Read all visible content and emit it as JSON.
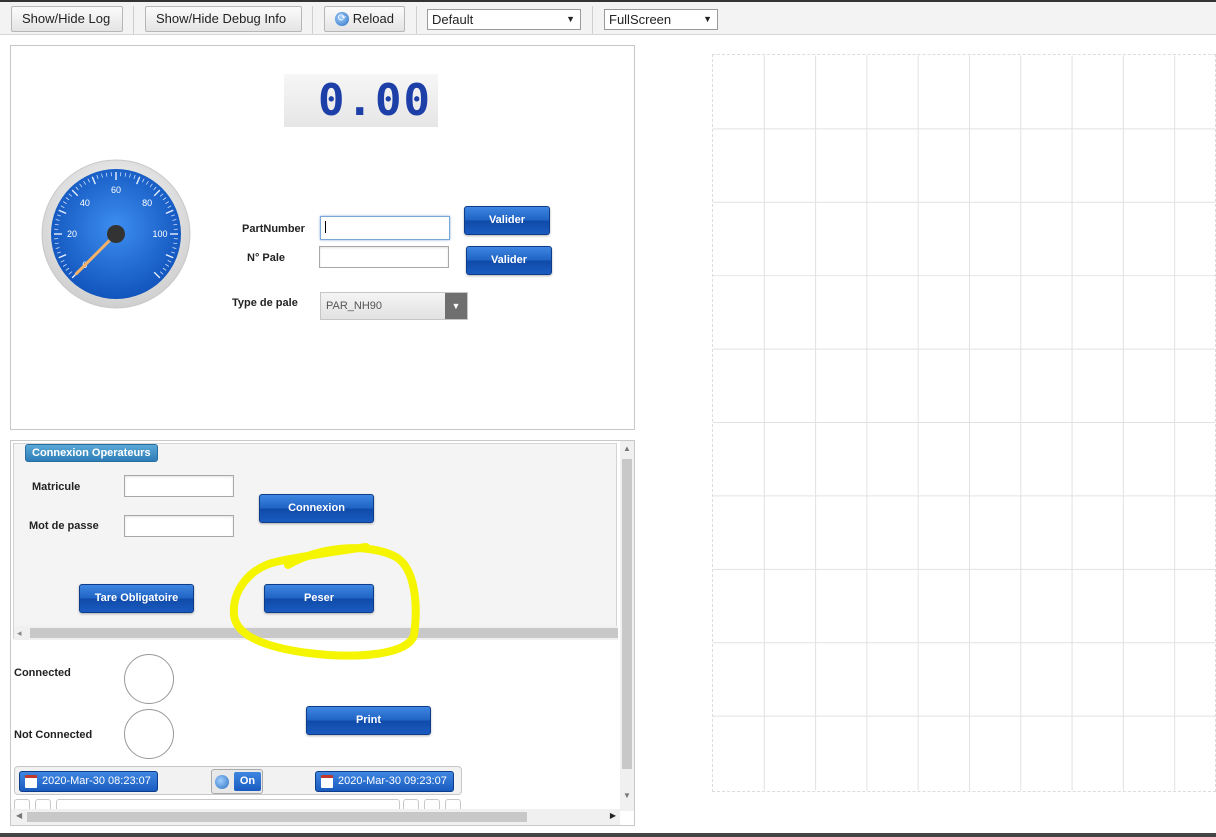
{
  "toolbar": {
    "show_hide_log": "Show/Hide Log",
    "show_hide_debug": "Show/Hide Debug Info",
    "reload": "Reload",
    "profile_select": "Default",
    "mode_select": "FullScreen"
  },
  "scale": {
    "display_value": "0.00",
    "gauge": {
      "ticks": [
        "0",
        "20",
        "40",
        "60",
        "80",
        "100"
      ],
      "needle_value": 0,
      "min": 0,
      "max": 120
    }
  },
  "form": {
    "partnumber_label": "PartNumber",
    "partnumber_value": "",
    "pale_label": "N° Pale",
    "pale_value": "",
    "valider_1": "Valider",
    "valider_2": "Valider",
    "type_label": "Type de pale",
    "type_value": "PAR_NH90"
  },
  "operators": {
    "legend": "Connexion Operateurs",
    "matricule_label": "Matricule",
    "password_label": "Mot de passe",
    "connexion_button": "Connexion",
    "tare_button": "Tare Obligatoire",
    "peser_button": "Peser"
  },
  "status": {
    "connected_label": "Connected",
    "not_connected_label": "Not Connected",
    "print_button": "Print"
  },
  "datebar": {
    "start": "2020-Mar-30 08:23:07",
    "toggle": "On",
    "end": "2020-Mar-30 09:23:07"
  },
  "colors": {
    "accent_blue": "#1f62c4",
    "display_digits": "#1d3fa8",
    "highlight": "#f5f500"
  }
}
